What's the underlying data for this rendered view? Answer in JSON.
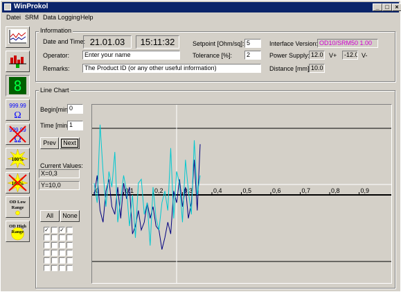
{
  "window": {
    "title": "WinProkol"
  },
  "menu": [
    "Datei",
    "SRM",
    "Data Logging",
    "Help"
  ],
  "info": {
    "group_label": "Information",
    "date_time_label": "Date and Time:",
    "date": "21.01.03",
    "time": "15:11:32",
    "operator_label": "Operator:",
    "operator_value": "Enter your name",
    "remarks_label": "Remarks:",
    "remarks_value": "The Product ID (or any other useful information)",
    "setpoint_label": "Setpoint [Ohm/sq]:",
    "setpoint_value": "5",
    "tolerance_label": "Tolerance [%]:",
    "tolerance_value": "2",
    "interface_label": "Interface Version:",
    "interface_value": "OD10/SRM50 1.00",
    "power_label": "Power Supply:",
    "power_plus": "12.0",
    "power_plus_unit": "V+",
    "power_minus": "-12.0",
    "power_minus_unit": "V-",
    "distance_label": "Distance [mm]:",
    "distance_value": "10.0"
  },
  "linechart": {
    "group_label": "Line Chart",
    "begin_label": "Begin[min]",
    "begin_value": "0",
    "time_label": "Time [min]",
    "time_value": "1",
    "prev_label": "Prev",
    "next_label": "Next",
    "current_values_label": "Current Values:",
    "x_value": "X=0,3",
    "y_value": "Y=10,0",
    "all_label": "All",
    "none_label": "None",
    "checkboxes": [
      [
        true,
        false,
        true,
        false
      ],
      [
        false,
        false,
        false,
        false
      ],
      [
        false,
        false,
        false,
        false
      ],
      [
        false,
        false,
        false,
        false
      ],
      [
        false,
        false,
        false,
        false
      ],
      [
        false,
        false,
        false,
        false
      ]
    ]
  },
  "sidebar": {
    "b1": "999.99",
    "b2": "999.99",
    "b3": "100%",
    "b4": "100%",
    "b5a": "OD Low",
    "b5b": "Range",
    "b6a": "OD High",
    "b6b": "Range"
  },
  "chart_data": {
    "type": "line",
    "x_ticks": [
      "0",
      "0,1",
      "0,2",
      "0,3",
      "0,4",
      "0,5",
      "0,6",
      "0,7",
      "0,8",
      "0,9"
    ],
    "xlim": [
      0,
      1
    ],
    "cursor_x": 0.28,
    "series": [
      {
        "color": "#000080",
        "x": [
          0,
          0.01,
          0.02,
          0.03,
          0.04,
          0.05,
          0.06,
          0.07,
          0.08,
          0.09,
          0.1,
          0.11,
          0.12,
          0.13,
          0.14,
          0.15,
          0.16,
          0.17,
          0.18,
          0.19,
          0.2,
          0.21,
          0.22,
          0.23,
          0.24,
          0.25,
          0.26,
          0.27,
          0.28,
          0.29,
          0.3,
          0.31,
          0.32,
          0.33,
          0.34,
          0.35,
          0.36
        ],
        "y": [
          0,
          0.5,
          -0.4,
          -0.7,
          0.1,
          0.4,
          -0.3,
          -0.5,
          0.2,
          -0.6,
          0.3,
          -0.1,
          0.2,
          -1.0,
          -0.8,
          -0.4,
          -0.9,
          -0.7,
          -0.2,
          -0.6,
          -0.3,
          -0.8,
          -0.9,
          -1.4,
          -1.1,
          -0.7,
          -1.0,
          0.1,
          -0.2,
          0.4,
          -0.3,
          0.2,
          -0.6,
          -0.2,
          0.9,
          -0.4,
          1.3
        ]
      },
      {
        "color": "#00c8d0",
        "x": [
          0,
          0.01,
          0.02,
          0.03,
          0.04,
          0.05,
          0.06,
          0.07,
          0.08,
          0.09,
          0.1,
          0.11,
          0.12,
          0.13,
          0.14,
          0.15,
          0.16,
          0.17,
          0.18,
          0.19,
          0.2,
          0.21,
          0.22,
          0.23,
          0.24,
          0.25,
          0.26,
          0.27,
          0.28,
          0.29,
          0.3,
          0.31,
          0.32,
          0.33,
          0.34,
          0.35,
          0.36
        ],
        "y": [
          0.3,
          -0.2,
          1.8,
          0.6,
          -0.3,
          0.6,
          0.2,
          1.1,
          -0.7,
          -0.1,
          0.5,
          0.1,
          -0.8,
          0.0,
          -1.1,
          0.3,
          0.4,
          -0.5,
          -0.2,
          -1.3,
          0.2,
          -0.6,
          -0.9,
          -0.2,
          0.1,
          -0.4,
          1.2,
          -0.6,
          0.6,
          0.3,
          -0.7,
          0.9,
          0.1,
          -0.5,
          1.4,
          0.0,
          0.5
        ]
      }
    ]
  }
}
